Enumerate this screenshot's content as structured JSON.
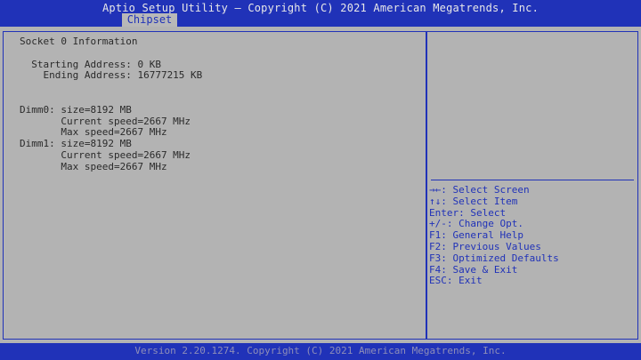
{
  "header": {
    "title": "Aptio Setup Utility – Copyright (C) 2021 American Megatrends, Inc.",
    "active_tab": "Chipset"
  },
  "info": {
    "section_title": "Socket 0 Information",
    "starting_address": "  Starting Address: 0 KB",
    "ending_address": "    Ending Address: 16777215 KB",
    "dimm0_size": "Dimm0: size=8192 MB",
    "dimm0_current": "       Current speed=2667 MHz",
    "dimm0_max": "       Max speed=2667 MHz",
    "dimm1_size": "Dimm1: size=8192 MB",
    "dimm1_current": "       Current speed=2667 MHz",
    "dimm1_max": "       Max speed=2667 MHz"
  },
  "help": {
    "keys": [
      {
        "key": "→←",
        "desc": ": Select Screen"
      },
      {
        "key": "↑↓",
        "desc": ": Select Item"
      },
      {
        "key": "Enter",
        "desc": ": Select"
      },
      {
        "key": "+/-",
        "desc": ": Change Opt."
      },
      {
        "key": "F1",
        "desc": ": General Help"
      },
      {
        "key": "F2",
        "desc": ": Previous Values"
      },
      {
        "key": "F3",
        "desc": ": Optimized Defaults"
      },
      {
        "key": "F4",
        "desc": ": Save & Exit"
      },
      {
        "key": "ESC",
        "desc": ": Exit"
      }
    ]
  },
  "footer": {
    "version": "Version 2.20.1274. Copyright (C) 2021 American Megatrends, Inc."
  },
  "colors": {
    "bios_blue": "#2032b8",
    "panel_gray": "#b3b3b3",
    "text_dark": "#2a2a2a"
  }
}
